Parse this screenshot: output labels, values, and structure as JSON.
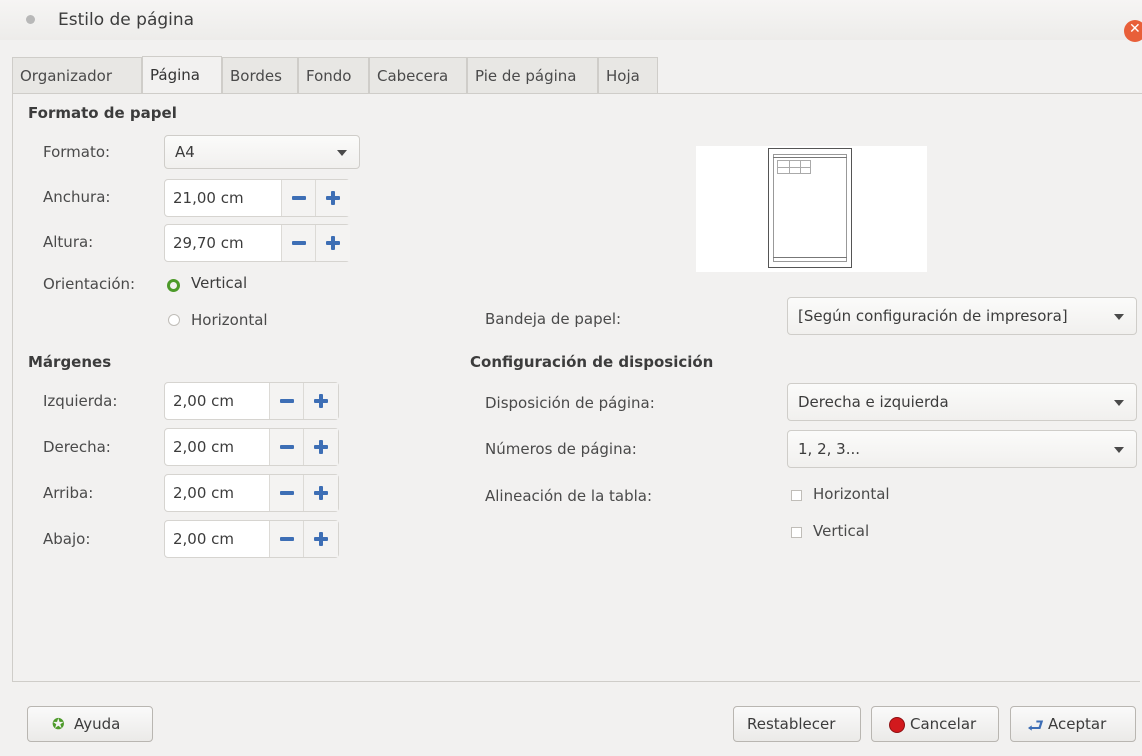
{
  "window": {
    "title": "Estilo de página"
  },
  "tabs": [
    "Organizador",
    "Página",
    "Bordes",
    "Fondo",
    "Cabecera",
    "Pie de página",
    "Hoja"
  ],
  "active_tab": "Página",
  "paper_format": {
    "heading": "Formato de papel",
    "format_label": "Formato:",
    "format_value": "A4",
    "width_label": "Anchura:",
    "width_value": "21,00 cm",
    "height_label": "Altura:",
    "height_value": "29,70 cm",
    "orientation_label": "Orientación:",
    "orientation_options": [
      "Vertical",
      "Horizontal"
    ],
    "orientation_selected": "Vertical"
  },
  "paper_tray": {
    "label": "Bandeja de papel:",
    "value": "[Según configuración de impresora]"
  },
  "margins": {
    "heading": "Márgenes",
    "left_label": "Izquierda:",
    "left_value": "2,00 cm",
    "right_label": "Derecha:",
    "right_value": "2,00 cm",
    "top_label": "Arriba:",
    "top_value": "2,00 cm",
    "bottom_label": "Abajo:",
    "bottom_value": "2,00 cm"
  },
  "layout": {
    "heading": "Configuración de disposición",
    "page_layout_label": "Disposición de página:",
    "page_layout_value": "Derecha e izquierda",
    "page_numbers_label": "Números de página:",
    "page_numbers_value": "1, 2, 3...",
    "table_alignment_label": "Alineación de la tabla:",
    "table_alignment_options": [
      "Horizontal",
      "Vertical"
    ]
  },
  "buttons": {
    "help": "Ayuda",
    "reset": "Restablecer",
    "cancel": "Cancelar",
    "ok": "Aceptar"
  },
  "colors": {
    "accent": "#3d6eb5",
    "radio_checked": "#4d9a2a",
    "close": "#e85f39",
    "cancel_icon": "#d2191d"
  }
}
